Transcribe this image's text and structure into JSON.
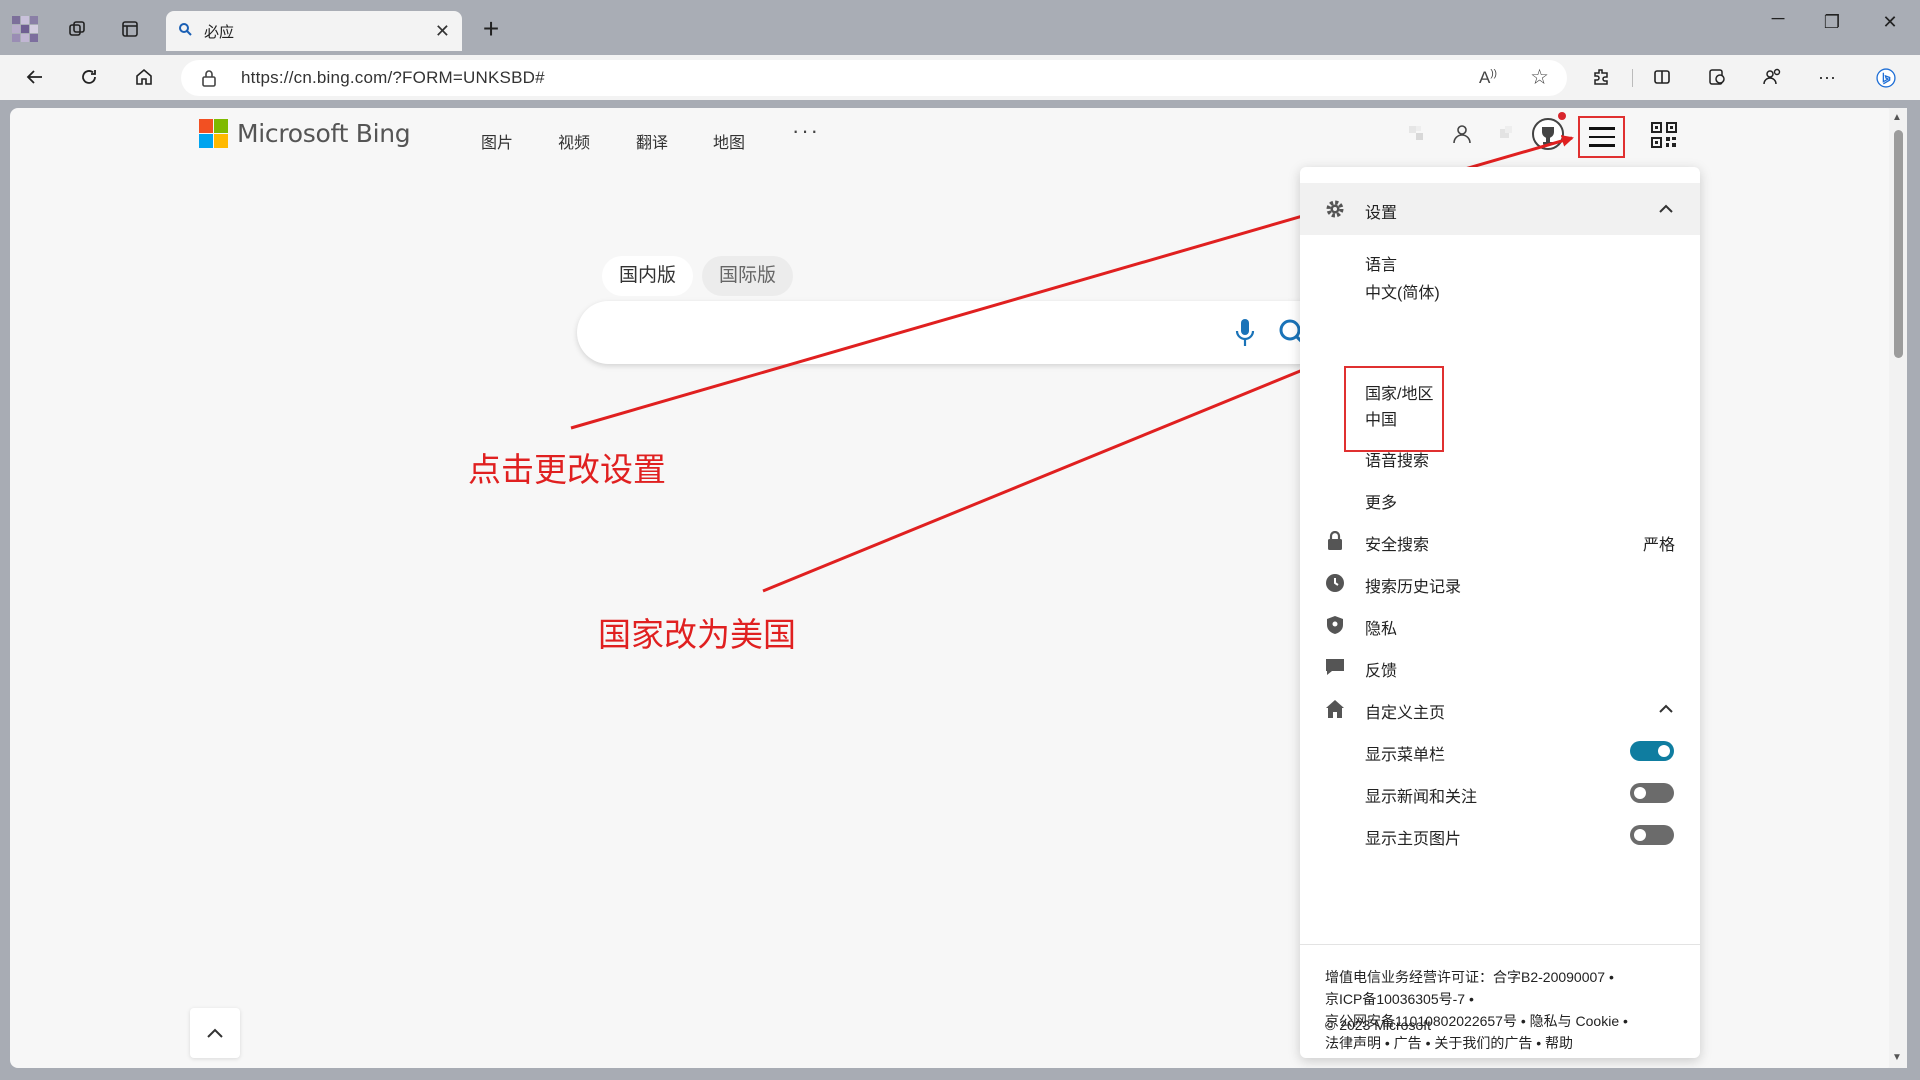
{
  "tab": {
    "title": "必应"
  },
  "address": {
    "url": "https://cn.bing.com/?FORM=UNKSBD#"
  },
  "bing": {
    "logo_text": "Microsoft Bing",
    "nav": [
      "图片",
      "视频",
      "翻译",
      "地图"
    ],
    "nav_more": "···",
    "scopes": [
      "国内版",
      "国际版"
    ],
    "search_placeholder": ""
  },
  "annotations": {
    "click_settings": "点击更改设置",
    "change_country": "国家改为美国"
  },
  "settings": {
    "header": "设置",
    "language_label": "语言",
    "language_value": "中文(简体)",
    "country_label": "国家/地区",
    "country_value": "中国",
    "voice_search": "语音搜索",
    "more": "更多",
    "safesearch_label": "安全搜索",
    "safesearch_value": "严格",
    "history": "搜索历史记录",
    "privacy": "隐私",
    "feedback": "反馈",
    "customize": "自定义主页",
    "toggles": [
      {
        "label": "显示菜单栏",
        "on": true
      },
      {
        "label": "显示新闻和关注",
        "on": false
      },
      {
        "label": "显示主页图片",
        "on": false
      }
    ],
    "footer": [
      "增值电信业务经营许可证：合字B2-20090007 •",
      "京ICP备10036305号-7 •",
      "京公网安备11010802022657号 • 隐私与 Cookie •",
      "法律声明 • 广告 • 关于我们的广告 • 帮助",
      "© 2023 Microsoft"
    ]
  },
  "colors": {
    "annotation": "#e02020",
    "toggle_on": "#0f7da0"
  }
}
